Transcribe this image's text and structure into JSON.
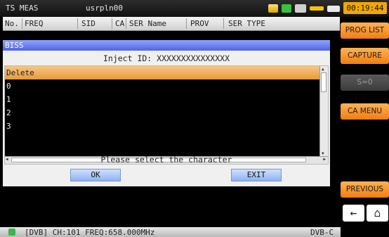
{
  "topbar": {
    "app_title": "TS MEAS",
    "user": "usrpln00",
    "time": "00:19:44",
    "status_icons": [
      "signal-icon",
      "media-icon",
      "tso-icon",
      "usb-icon",
      "battery-icon"
    ],
    "colors": {
      "time_bg": "#f1a800"
    }
  },
  "table_header": {
    "columns": [
      "No.",
      "FREQ",
      "SID",
      "CA",
      "SER Name",
      "PROV",
      "SER TYPE"
    ]
  },
  "dialog": {
    "title": "BISS",
    "inject_label": "Inject ID: XXXXXXXXXXXXXXX",
    "list_items": [
      "Delete",
      "0",
      "1",
      "2",
      "3"
    ],
    "selected_index": 0,
    "prompt": "Please select the character",
    "ok_label": "OK",
    "exit_label": "EXIT"
  },
  "right_panel": {
    "buttons": [
      {
        "label": "PROG LIST",
        "state": "enabled"
      },
      {
        "label": "CAPTURE",
        "state": "enabled"
      },
      {
        "label": "S=0",
        "state": "disabled"
      },
      {
        "label": "CA MENU",
        "state": "enabled"
      },
      {
        "label": "PREVIOUS",
        "state": "enabled"
      }
    ],
    "back_icon": "←",
    "home_icon": "⌂",
    "colors": {
      "accent": "#f07d12"
    }
  },
  "status_bar": {
    "info": "[DVB] CH:101 FREQ:658.000MHz",
    "standard": "DVB-C"
  }
}
